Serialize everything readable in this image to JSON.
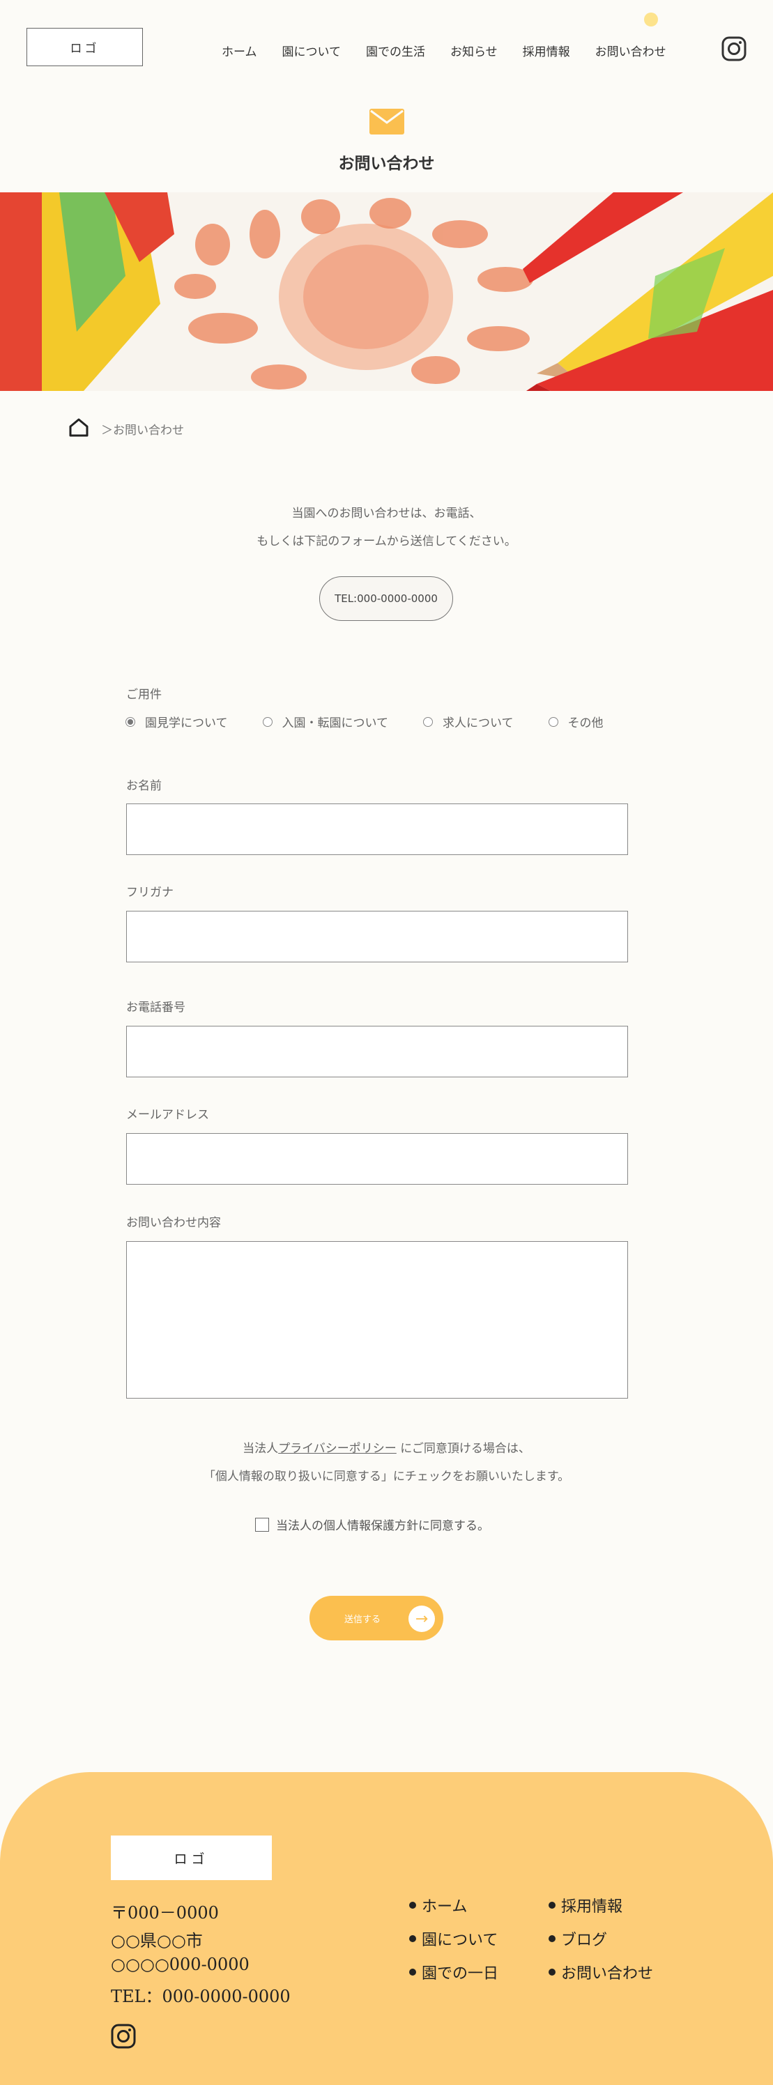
{
  "header": {
    "logo": "ロゴ",
    "nav": [
      "ホーム",
      "園について",
      "園での生活",
      "お知らせ",
      "採用情報",
      "お問い合わせ"
    ],
    "instagram_icon": "instagram-icon"
  },
  "page": {
    "title": "お問い合わせ",
    "title_icon": "mail-icon",
    "breadcrumb": "＞お問い合わせ"
  },
  "intro": {
    "line1": "当園へのお問い合わせは、お電話、",
    "line2": "もしくは下記のフォームから送信してください。",
    "tel": "TEL:000-0000-0000"
  },
  "form": {
    "purpose_label": "ご用件",
    "purpose_options": [
      "園見学について",
      "入園・転園について",
      "求人について",
      "その他"
    ],
    "purpose_selected": "園見学について",
    "name_label": "お名前",
    "name_value": "",
    "kana_label": "フリガナ",
    "kana_value": "",
    "phone_label": "お電話番号",
    "phone_value": "",
    "email_label": "メールアドレス",
    "email_value": "",
    "message_label": "お問い合わせ内容",
    "message_value": "",
    "policy_prefix": "当法人",
    "policy_link": "プライバシーポリシー",
    "policy_suffix": "にご同意頂ける場合は、",
    "policy_line2": "「個人情報の取り扱いに同意する」にチェックをお願いいたします。",
    "agree_label": "当法人の個人情報保護方針に同意する。",
    "agree_checked": false,
    "submit_label": "送信する"
  },
  "footer": {
    "logo": "ロゴ",
    "address": [
      "〒000－0000",
      "○○県○○市",
      "○○○○000-0000",
      "TEL：000-0000-0000"
    ],
    "links_col1": [
      "ホーム",
      "園について",
      "園での一日"
    ],
    "links_col2": [
      "採用情報",
      "ブログ",
      "お問い合わせ"
    ]
  },
  "colors": {
    "accent": "#fbbf4f",
    "footer_bg": "#fdcd78",
    "page_bg": "#fcfbf7"
  }
}
